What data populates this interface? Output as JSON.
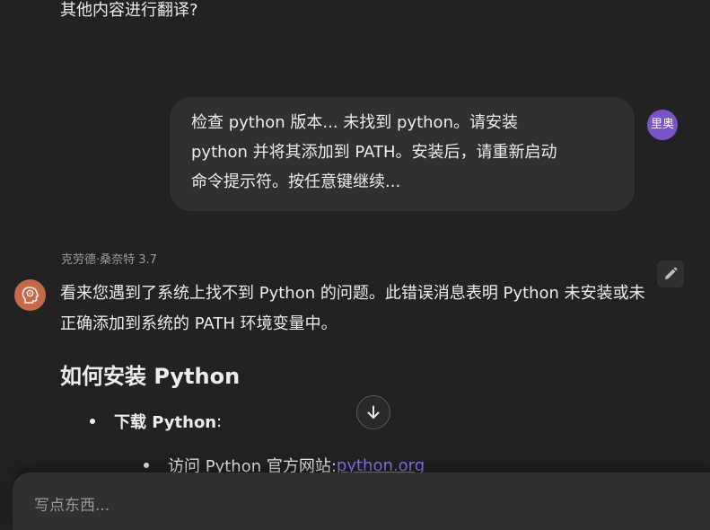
{
  "previous_message": {
    "tail_text": "其他内容进行翻译?"
  },
  "user_message": {
    "lines": [
      "检查 python 版本... 未找到 python。请安装",
      "python 并将其添加到 PATH。安装后，请重新启动",
      "命令提示符。按任意键继续..."
    ],
    "avatar_text": "里奥",
    "avatar_color": "#7b52c9"
  },
  "assistant_message": {
    "model_name": "克劳德·桑奈特 3.7",
    "avatar_icon": "brain-head-icon",
    "edit_icon": "pencil-icon",
    "paragraph_lines": [
      "看来您遇到了系统上找不到 Python 的问题。此错误消息表明 Python 未安装或未",
      "正确添加到系统的 PATH 环境变量中。"
    ],
    "heading": "如何安装 Python",
    "bullet": {
      "label": "下载 Python",
      "colon": ":",
      "sub_bullet": {
        "text": "访问 Python 官方网站: ",
        "link": "python.org"
      }
    }
  },
  "scroll_button": {
    "icon": "arrow-down-icon"
  },
  "composer": {
    "placeholder": "写点东西..."
  },
  "colors": {
    "background": "#222222",
    "bubble": "#303030",
    "link": "#8b7cf6",
    "bot_avatar": "#c46a4a"
  }
}
